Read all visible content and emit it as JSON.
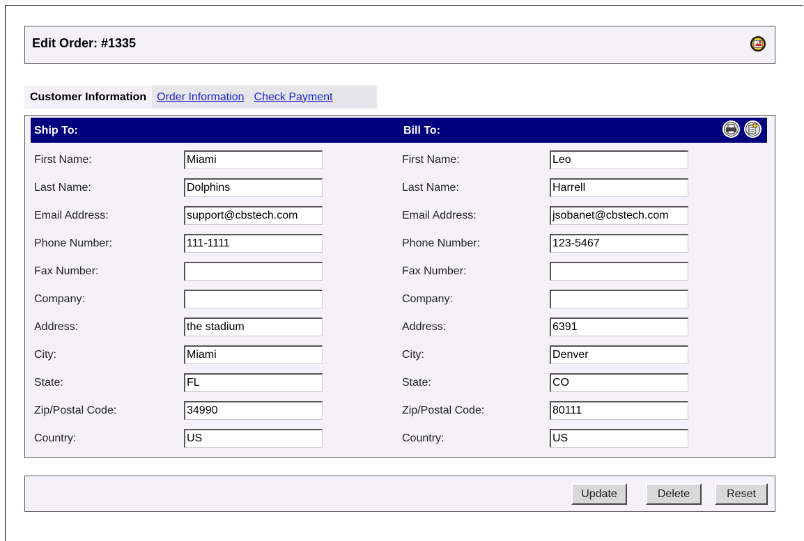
{
  "header": {
    "title": "Edit Order: #1335"
  },
  "tabs": [
    {
      "label": "Customer Information",
      "active": true
    },
    {
      "label": "Order Information",
      "active": false
    },
    {
      "label": "Check Payment",
      "active": false
    }
  ],
  "ship": {
    "heading": "Ship To:",
    "labels": [
      "First Name:",
      "Last Name:",
      "Email Address:",
      "Phone Number:",
      "Fax Number:",
      "Company:",
      "Address:",
      "City:",
      "State:",
      "Zip/Postal Code:",
      "Country:"
    ],
    "values": [
      "Miami",
      "Dolphins",
      "support@cbstech.com",
      "111-1111",
      "",
      "",
      "the stadium",
      "Miami",
      "FL",
      "34990",
      "US"
    ]
  },
  "bill": {
    "heading": "Bill To:",
    "labels": [
      "First Name:",
      "Last Name:",
      "Email Address:",
      "Phone Number:",
      "Fax Number:",
      "Company:",
      "Address:",
      "City:",
      "State:",
      "Zip/Postal Code:",
      "Country:"
    ],
    "values": [
      "Leo",
      "Harrell",
      "jsobanet@cbstech.com",
      "123-5467",
      "",
      "",
      "6391",
      "Denver",
      "CO",
      "80111",
      "US"
    ]
  },
  "buttons": {
    "update": "Update",
    "delete": "Delete",
    "reset": "Reset"
  },
  "colors": {
    "panel_header": "#00007e",
    "panel_bg": "#f4f2f6",
    "link": "#2222cc"
  }
}
